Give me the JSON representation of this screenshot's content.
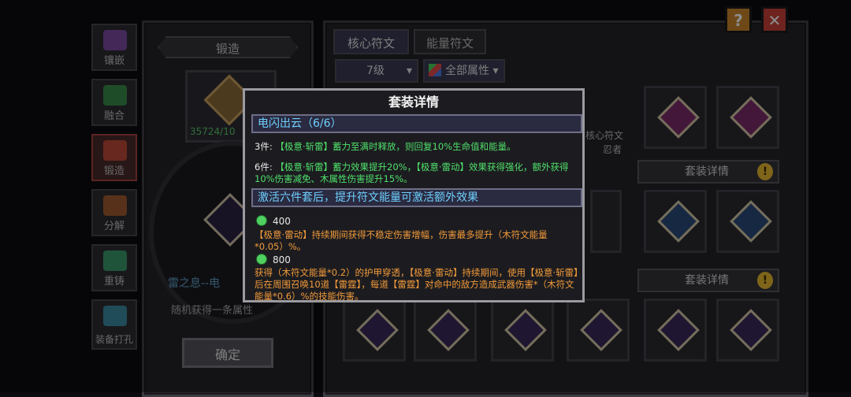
{
  "sidebar": {
    "tabs": [
      {
        "label": "镶嵌",
        "color": "#7a4aa0"
      },
      {
        "label": "融合",
        "color": "#3a8a4a"
      },
      {
        "label": "锻造",
        "color": "#c04a3a"
      },
      {
        "label": "分解",
        "color": "#a05a30"
      },
      {
        "label": "重铸",
        "color": "#3a9a6a"
      },
      {
        "label": "装备打孔",
        "color": "#3a8aa0"
      }
    ],
    "active_index": 2
  },
  "forge": {
    "title": "锻造",
    "material_count": "35724/10",
    "rune_name": "雷之息--电",
    "random_text": "随机获得一条属性",
    "confirm_label": "确定"
  },
  "rune_panel": {
    "tabs": [
      "核心符文",
      "能量符文"
    ],
    "active_tab": 0,
    "level_filter": "7级",
    "attr_filter": "全部属性",
    "card_title": "核心符文",
    "card_subtitle": "忍者",
    "set_detail_label": "套装详情"
  },
  "top_buttons": {
    "help": "?",
    "close": "✕"
  },
  "modal": {
    "title": "套装详情",
    "set_name": "电闪出云（6/6）",
    "piece3_label": "3件:",
    "piece3_text": "【极意·斩雷】蓄力至满时释放，则回复10%生命值和能量。",
    "piece6_label": "6件:",
    "piece6_text": "【极意·斩雷】蓄力效果提升20%，【极意·雷动】效果获得强化，额外获得10%伤害减免、木属性伤害提升15%。",
    "extra_header": "激活六件套后，提升符文能量可激活额外效果",
    "tier1_cost": "400",
    "tier1_text": "【极意·雷动】持续期间获得不稳定伤害增幅，伤害最多提升（木符文能量*0.05）%。",
    "tier2_cost": "800",
    "tier2_text": "获得（木符文能量*0.2）的护甲穿透，【极意·雷动】持续期间，使用【极意·斩雷】后在周围召唤10道【雷霆】，每道【雷霆】对命中的敌方造成武器伤害*（木符文能量*0.6）%的技能伤害。"
  }
}
